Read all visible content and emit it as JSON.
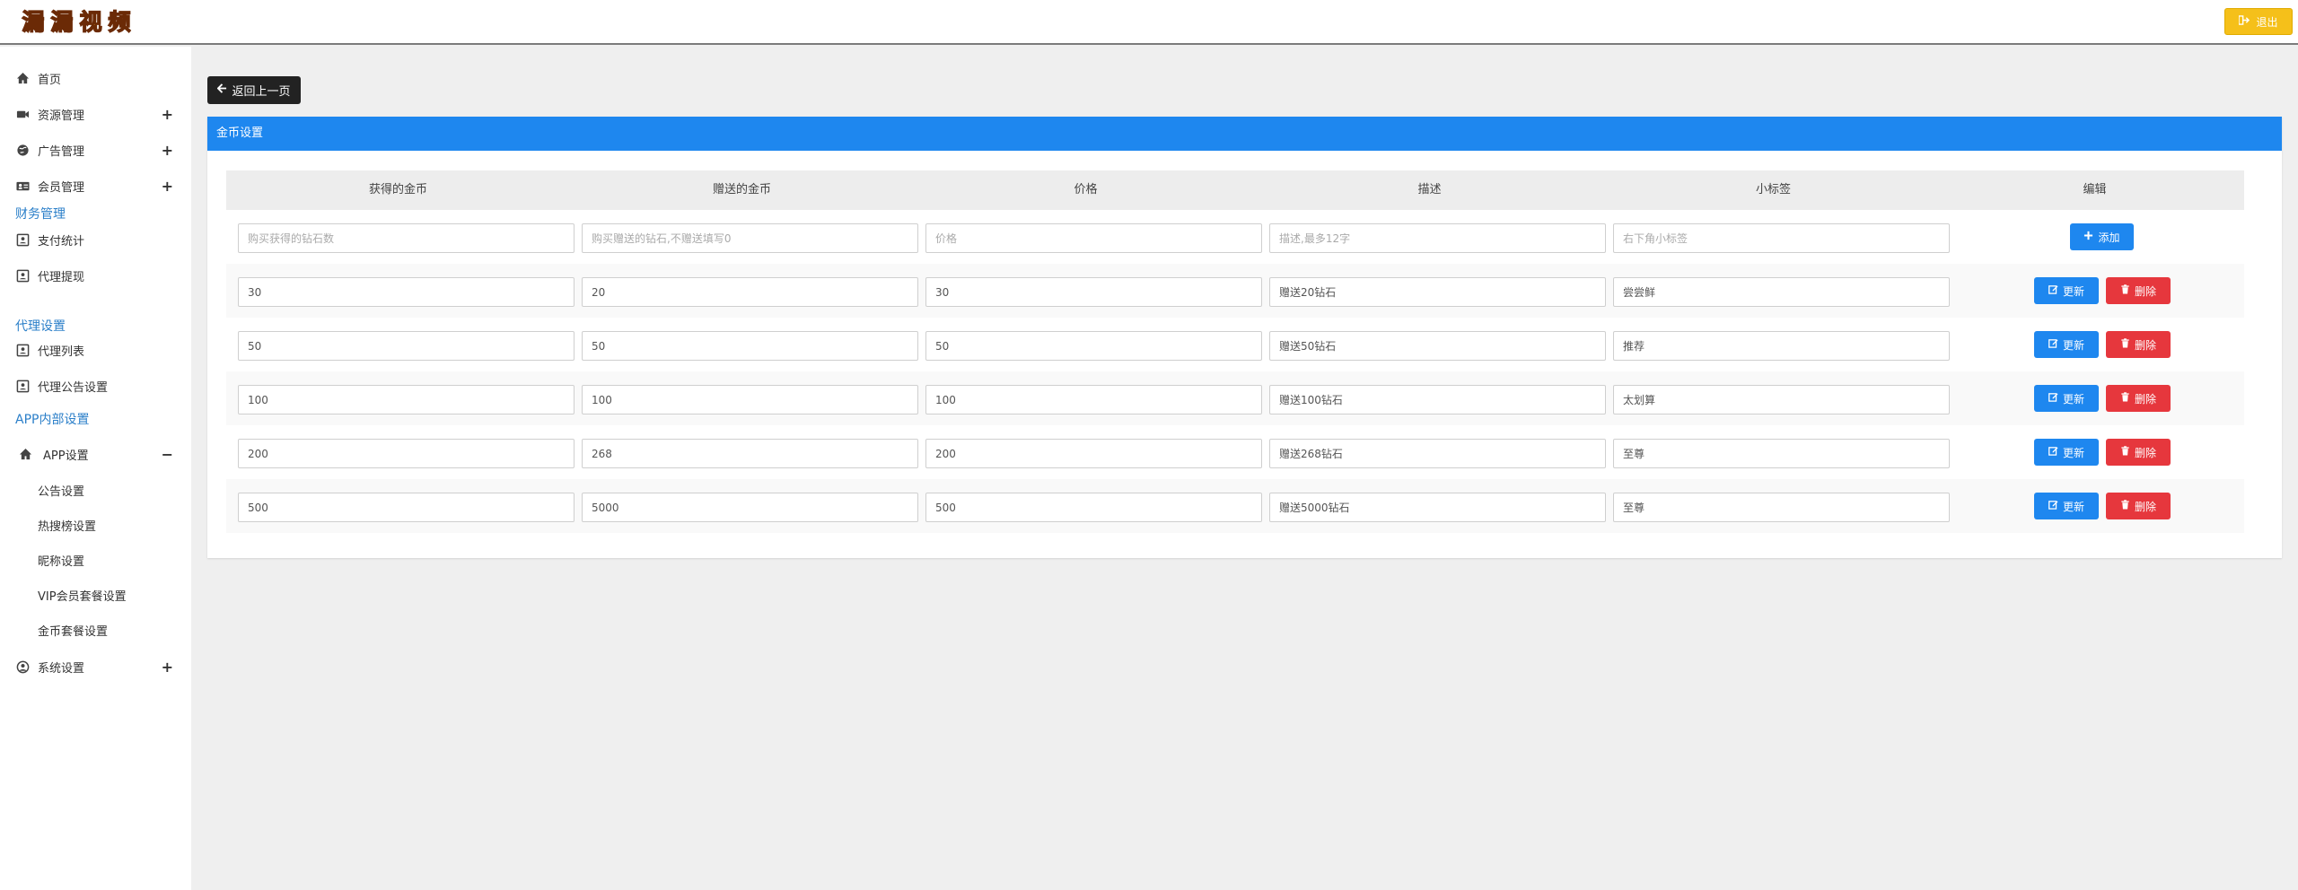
{
  "app": {
    "logo_chars": [
      "漏",
      "漏",
      "视",
      "频"
    ],
    "logout_label": "退出"
  },
  "sidebar": {
    "items": [
      {
        "label": "首页",
        "icon": "home-icon"
      },
      {
        "label": "资源管理",
        "icon": "video-camera-icon",
        "expand": "+"
      },
      {
        "label": "广告管理",
        "icon": "globe-icon",
        "expand": "+"
      },
      {
        "label": "会员管理",
        "icon": "id-card-icon",
        "expand": "+"
      }
    ],
    "section_finance": "财务管理",
    "finance_items": [
      {
        "label": "支付统计",
        "icon": "user-card-icon"
      },
      {
        "label": "代理提现",
        "icon": "user-card-icon"
      }
    ],
    "section_agent": "代理设置",
    "agent_items": [
      {
        "label": "代理列表",
        "icon": "user-card-icon"
      },
      {
        "label": "代理公告设置",
        "icon": "user-card-icon"
      }
    ],
    "section_app": "APP内部设置",
    "app_settings": {
      "label": "APP设置",
      "icon": "home-icon",
      "expand": "−"
    },
    "app_sub_items": [
      "公告设置",
      "热搜榜设置",
      "昵称设置",
      "VIP会员套餐设置",
      "金币套餐设置"
    ],
    "system": {
      "label": "系统设置",
      "icon": "user-circle-icon",
      "expand": "+"
    }
  },
  "main": {
    "back_label": "返回上一页",
    "panel_title": "金币设置",
    "columns": [
      "获得的金币",
      "赠送的金币",
      "价格",
      "描述",
      "小标签",
      "编辑"
    ],
    "new_row_placeholders": [
      "购买获得的钻石数",
      "购买赠送的钻石,不赠送填写0",
      "价格",
      "描述,最多12字",
      "右下角小标签"
    ],
    "add_label": "添加",
    "update_label": "更新",
    "delete_label": "删除",
    "rows": [
      [
        "30",
        "20",
        "30",
        "赠送20钻石",
        "尝尝鲜"
      ],
      [
        "50",
        "50",
        "50",
        "赠送50钻石",
        "推荐"
      ],
      [
        "100",
        "100",
        "100",
        "赠送100钻石",
        "太划算"
      ],
      [
        "200",
        "268",
        "200",
        "赠送268钻石",
        "至尊"
      ],
      [
        "500",
        "5000",
        "500",
        "赠送5000钻石",
        "至尊"
      ]
    ]
  },
  "colors": {
    "primary": "#1e87ef",
    "danger": "#e6373d",
    "warning": "#f5c01a",
    "section_link": "#2b7fc9"
  }
}
